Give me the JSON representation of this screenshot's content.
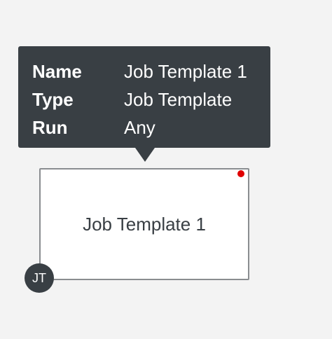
{
  "tooltip": {
    "rows": [
      {
        "key": "Name",
        "value": "Job Template 1"
      },
      {
        "key": "Type",
        "value": "Job Template"
      },
      {
        "key": "Run",
        "value": "Any"
      }
    ]
  },
  "node": {
    "label": "Job Template 1",
    "type_badge": "JT",
    "status_color": "#e00000"
  },
  "colors": {
    "tooltip_bg": "#393f44",
    "node_border": "#8a8d90",
    "canvas_bg": "#f3f3f3"
  }
}
